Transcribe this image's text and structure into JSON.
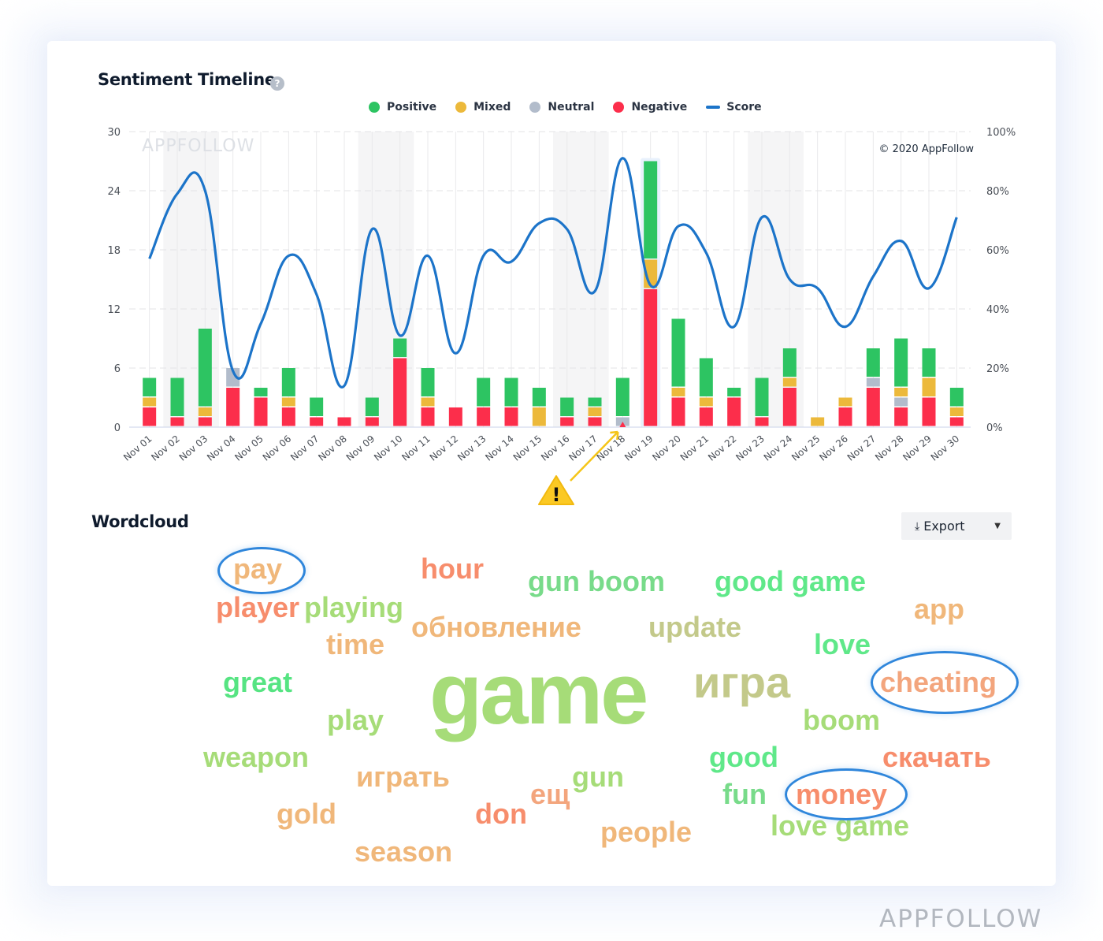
{
  "timeline": {
    "title": "Sentiment Timeline",
    "help_icon": "question-circle-icon",
    "watermark": "APPFOLLOW",
    "copyright": "© 2020 AppFollow"
  },
  "legend": [
    {
      "label": "Positive",
      "color": "#2dc462",
      "kind": "dot"
    },
    {
      "label": "Mixed",
      "color": "#ecb93b",
      "kind": "dot"
    },
    {
      "label": "Neutral",
      "color": "#b2bccb",
      "kind": "dot"
    },
    {
      "label": "Negative",
      "color": "#fc2e4b",
      "kind": "dot"
    },
    {
      "label": "Score",
      "color": "#1c74c9",
      "kind": "line"
    }
  ],
  "chart_data": {
    "type": "bar",
    "title": "Sentiment Timeline",
    "xlabel": "",
    "ylabel": "",
    "ylim": [
      0,
      30
    ],
    "y2lim": [
      0,
      100
    ],
    "yticks": [
      "0",
      "6",
      "12",
      "18",
      "24",
      "30"
    ],
    "y2ticks": [
      "0%",
      "20%",
      "40%",
      "60%",
      "80%",
      "100%"
    ],
    "grid": true,
    "legend_position": "top-center",
    "stacked": true,
    "categories": [
      "Nov 01",
      "Nov 02",
      "Nov 03",
      "Nov 04",
      "Nov 05",
      "Nov 06",
      "Nov 07",
      "Nov 08",
      "Nov 09",
      "Nov 10",
      "Nov 11",
      "Nov 12",
      "Nov 13",
      "Nov 14",
      "Nov 15",
      "Nov 16",
      "Nov 17",
      "Nov 18",
      "Nov 19",
      "Nov 20",
      "Nov 21",
      "Nov 22",
      "Nov 23",
      "Nov 24",
      "Nov 25",
      "Nov 26",
      "Nov 27",
      "Nov 28",
      "Nov 29",
      "Nov 30"
    ],
    "series": [
      {
        "name": "Negative",
        "color": "#fc2e4b",
        "values": [
          2,
          1,
          1,
          4,
          3,
          2,
          1,
          1,
          1,
          7,
          2,
          2,
          2,
          2,
          0,
          1,
          1,
          0,
          14,
          3,
          2,
          3,
          1,
          4,
          0,
          2,
          4,
          2,
          3,
          1
        ]
      },
      {
        "name": "Neutral",
        "color": "#b2bccb",
        "values": [
          0,
          0,
          0,
          2,
          0,
          0,
          0,
          0,
          0,
          0,
          0,
          0,
          0,
          0,
          0,
          0,
          0,
          1,
          0,
          0,
          0,
          0,
          0,
          0,
          0,
          0,
          1,
          1,
          0,
          0
        ]
      },
      {
        "name": "Mixed",
        "color": "#ecb93b",
        "values": [
          1,
          0,
          1,
          0,
          0,
          1,
          0,
          0,
          0,
          0,
          1,
          0,
          0,
          0,
          2,
          0,
          1,
          0,
          3,
          1,
          1,
          0,
          0,
          1,
          1,
          1,
          0,
          1,
          2,
          1
        ]
      },
      {
        "name": "Positive",
        "color": "#2dc462",
        "values": [
          2,
          4,
          8,
          0,
          1,
          3,
          2,
          0,
          2,
          2,
          3,
          0,
          3,
          3,
          2,
          2,
          1,
          4,
          10,
          7,
          4,
          1,
          4,
          3,
          0,
          0,
          3,
          5,
          3,
          2
        ]
      },
      {
        "name": "Score",
        "color": "#1c74c9",
        "type": "line",
        "axis": "right",
        "unit": "%",
        "values": [
          57,
          79,
          80,
          19,
          35,
          58,
          45,
          14,
          67,
          31,
          58,
          25,
          58,
          56,
          69,
          67,
          46,
          91,
          48,
          68,
          59,
          34,
          71,
          50,
          47,
          34,
          51,
          63,
          47,
          71
        ]
      }
    ],
    "shaded_ranges": [
      [
        "Nov 02",
        "Nov 03"
      ],
      [
        "Nov 09",
        "Nov 10"
      ],
      [
        "Nov 16",
        "Nov 17"
      ],
      [
        "Nov 23",
        "Nov 24"
      ]
    ],
    "highlighted_category": "Nov 19",
    "annotations": [
      {
        "category": "Nov 18",
        "type": "warning-marker",
        "icon": "warning-triangle-icon"
      }
    ]
  },
  "wordcloud": {
    "title": "Wordcloud",
    "export_label": "Export",
    "export_icon": "download-icon",
    "dropdown_icon": "caret-down-icon",
    "words": [
      {
        "text": "pay",
        "color": "#f0b77a",
        "circled": true
      },
      {
        "text": "hour",
        "color": "#f78d6c"
      },
      {
        "text": "gun boom",
        "color": "#78db8a"
      },
      {
        "text": "good game",
        "color": "#5fe889"
      },
      {
        "text": "app",
        "color": "#f0b77a"
      },
      {
        "text": "player",
        "color": "#f78d6c"
      },
      {
        "text": "playing",
        "color": "#a6dc78"
      },
      {
        "text": "обновление",
        "color": "#f0b77a"
      },
      {
        "text": "update",
        "color": "#c3c98a"
      },
      {
        "text": "time",
        "color": "#f0b77a"
      },
      {
        "text": "love",
        "color": "#5fe889"
      },
      {
        "text": "great",
        "color": "#56e482"
      },
      {
        "text": "game",
        "color": "#a6dc78"
      },
      {
        "text": "игра",
        "color": "#c3c98a"
      },
      {
        "text": "cheating",
        "color": "#f3a57d",
        "circled": true
      },
      {
        "text": "play",
        "color": "#a6dc78"
      },
      {
        "text": "boom",
        "color": "#a6dc78"
      },
      {
        "text": "weapon",
        "color": "#a6dc78"
      },
      {
        "text": "играть",
        "color": "#f0b77a"
      },
      {
        "text": "gun",
        "color": "#a6dc78"
      },
      {
        "text": "good",
        "color": "#5fe889"
      },
      {
        "text": "скачать",
        "color": "#f78d6c"
      },
      {
        "text": "ещ",
        "color": "#f3a57d"
      },
      {
        "text": "fun",
        "color": "#78db8a"
      },
      {
        "text": "money",
        "color": "#f78d6c",
        "circled": true
      },
      {
        "text": "gold",
        "color": "#f0b77a"
      },
      {
        "text": "don",
        "color": "#f78d6c"
      },
      {
        "text": "love game",
        "color": "#a6dc78"
      },
      {
        "text": "people",
        "color": "#f0b77a"
      },
      {
        "text": "season",
        "color": "#f0b77a"
      }
    ]
  },
  "footer": {
    "brand": "APPFOLLOW"
  }
}
